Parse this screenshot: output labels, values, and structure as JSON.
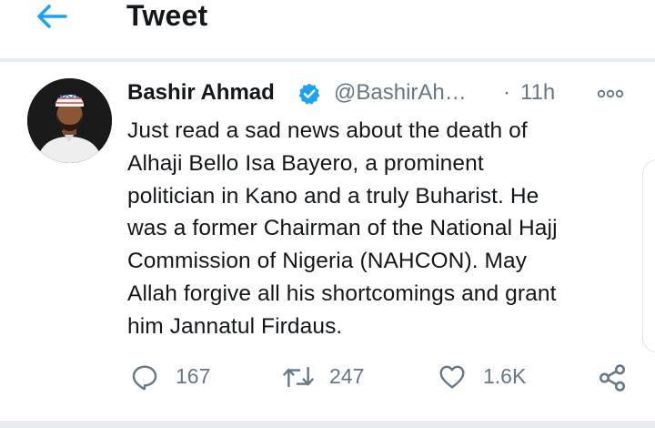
{
  "header": {
    "title": "Tweet",
    "back_icon": "arrow-left-icon"
  },
  "colors": {
    "accent": "#1da1f2",
    "secondary_text": "#657786",
    "primary_text": "#14171a",
    "divider": "#e6ecf0"
  },
  "tweet": {
    "author": {
      "name": "Bashir Ahmad",
      "handle": "@BashirAh…",
      "verified": true
    },
    "separator": "·",
    "time": "11h",
    "body_lines": [
      "Just read a sad news about the death of",
      "Alhaji Bello Isa Bayero, a prominent",
      "politician in Kano and a truly Buharist. He",
      "was a former Chairman of the National Hajj",
      "Commission of Nigeria (NAHCON). May",
      "Allah forgive all his shortcomings and grant",
      "him Jannatul Firdaus."
    ],
    "actions": {
      "replies": "167",
      "retweets": "247",
      "likes": "1.6K"
    }
  }
}
